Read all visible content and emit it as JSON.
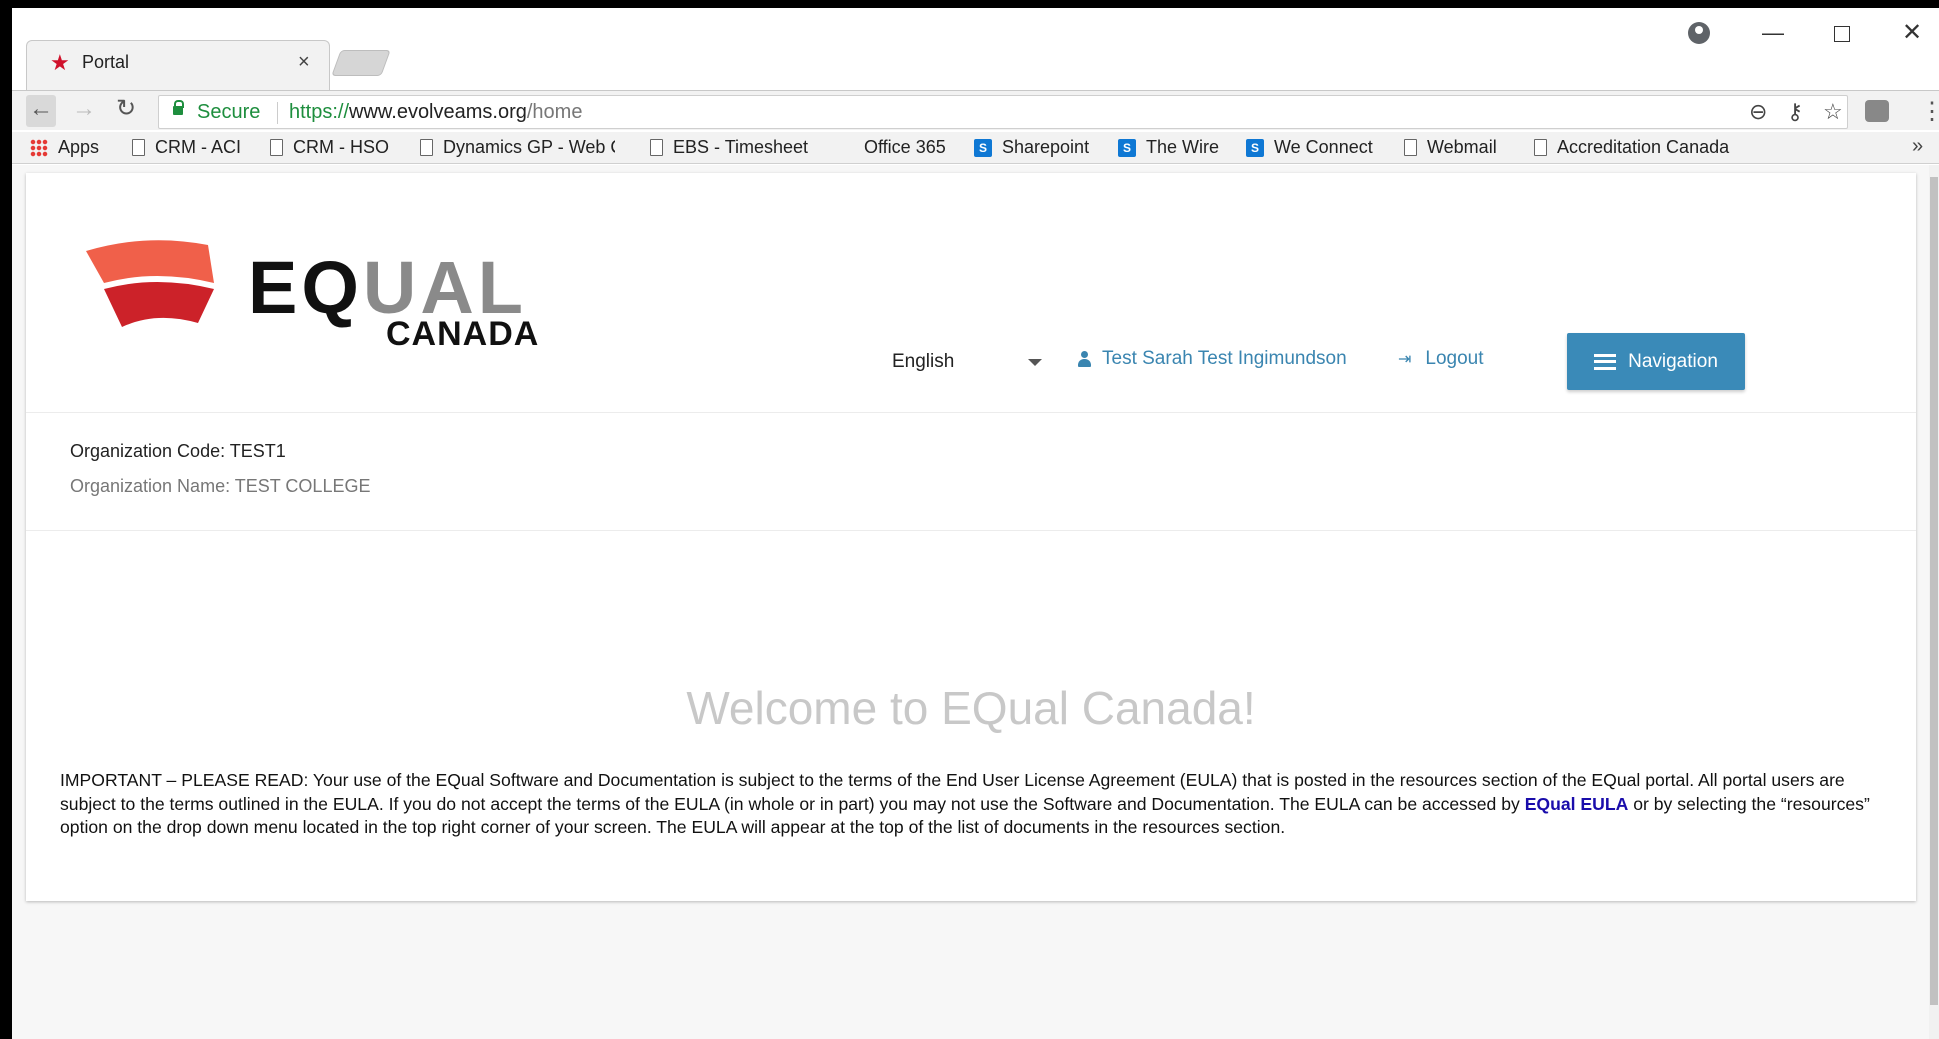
{
  "browser": {
    "tab_title": "Portal",
    "tab_close": "×",
    "secure_label": "Secure",
    "url_scheme": "https://",
    "url_host": "www.evolveams.org",
    "url_path": "/home",
    "bookmarks": [
      {
        "label": "Apps",
        "icon": "apps-grid-icon"
      },
      {
        "label": "CRM - ACI",
        "icon": "page-icon"
      },
      {
        "label": "CRM - HSO",
        "icon": "page-icon"
      },
      {
        "label": "Dynamics GP - Web C",
        "icon": "page-icon"
      },
      {
        "label": "EBS - Timesheet",
        "icon": "page-icon"
      },
      {
        "label": "Office 365",
        "icon": "office365-icon"
      },
      {
        "label": "Sharepoint",
        "icon": "sharepoint-icon"
      },
      {
        "label": "The Wire",
        "icon": "sharepoint-icon"
      },
      {
        "label": "We Connect",
        "icon": "sharepoint-icon"
      },
      {
        "label": "Webmail",
        "icon": "page-icon"
      },
      {
        "label": "Accreditation Canada",
        "icon": "page-icon"
      }
    ],
    "bookmarks_more": "»"
  },
  "header": {
    "logo_eq": "EQ",
    "logo_ual": "UAL",
    "logo_canada": "CANADA",
    "language": "English",
    "user_name": "Test Sarah Test Ingimundson",
    "logout": "Logout",
    "navigation": "Navigation"
  },
  "org": {
    "code": "Organization Code: TEST1",
    "name": "Organization Name: TEST COLLEGE"
  },
  "main": {
    "welcome": "Welcome to EQual Canada!",
    "notice_before": "IMPORTANT – PLEASE READ: Your use of the EQual Software and Documentation is subject to the terms of the End User License Agreement (EULA) that is posted in the resources section of the EQual portal. All portal users are subject to the terms outlined in the EULA. If you do not accept the terms of the EULA (in whole or in part) you may not use the Software and Documentation. The EULA can be accessed by ",
    "eula_link": "EQual EULA",
    "notice_after": " or by selecting the “resources” option on the drop down menu located in the top right corner of your screen. The EULA will appear at the top of the list of documents in the resources section."
  },
  "colors": {
    "accent": "#3a8ab8",
    "link": "#3a85b0",
    "logo_red": "#d32f2f",
    "logo_orange": "#f0604a"
  }
}
